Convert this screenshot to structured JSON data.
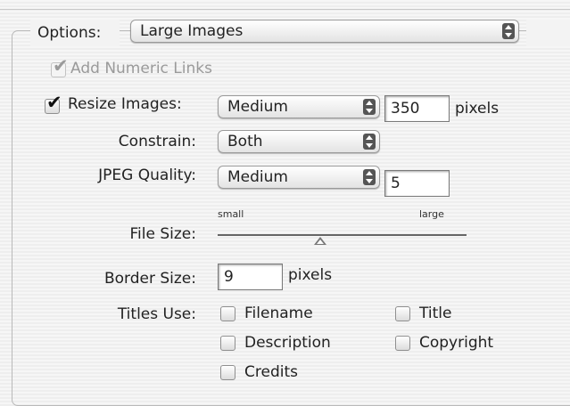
{
  "options": {
    "label": "Options:",
    "selected": "Large Images"
  },
  "add_numeric_links": {
    "label": "Add Numeric Links",
    "checked": true,
    "enabled": false
  },
  "resize_images": {
    "label": "Resize Images:",
    "checked": true,
    "size_selected": "Medium",
    "pixels_value": "350",
    "unit": "pixels"
  },
  "constrain": {
    "label": "Constrain:",
    "selected": "Both"
  },
  "jpeg_quality": {
    "label": "JPEG Quality:",
    "selected": "Medium",
    "value": "5"
  },
  "file_size": {
    "label": "File Size:",
    "min_label": "small",
    "max_label": "large",
    "level": 0.4
  },
  "border_size": {
    "label": "Border Size:",
    "value": "9",
    "unit": "pixels"
  },
  "titles_use": {
    "label": "Titles Use:",
    "options": [
      {
        "label": "Filename",
        "checked": false
      },
      {
        "label": "Title",
        "checked": false
      },
      {
        "label": "Description",
        "checked": false
      },
      {
        "label": "Copyright",
        "checked": false
      },
      {
        "label": "Credits",
        "checked": false
      }
    ]
  }
}
